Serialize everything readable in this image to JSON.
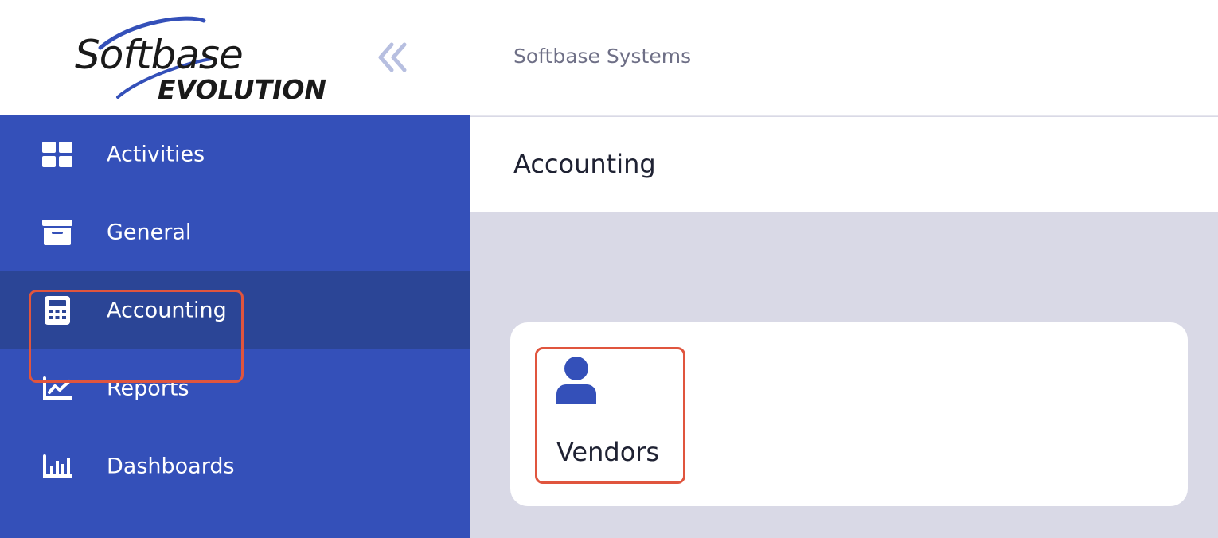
{
  "brand": {
    "logo_line1": "Softbase",
    "logo_line2": "EVOLUTION"
  },
  "header": {
    "org_name": "Softbase Systems",
    "page_title": "Accounting"
  },
  "sidebar": {
    "items": [
      {
        "label": "Activities",
        "icon": "grid-icon"
      },
      {
        "label": "General",
        "icon": "archive-box-icon"
      },
      {
        "label": "Accounting",
        "icon": "calculator-icon",
        "active": true
      },
      {
        "label": "Reports",
        "icon": "chart-line-icon"
      },
      {
        "label": "Dashboards",
        "icon": "bar-chart-icon"
      }
    ]
  },
  "main": {
    "tiles": [
      {
        "label": "Vendors",
        "icon": "user-icon"
      }
    ]
  },
  "colors": {
    "sidebar": "#3450b9",
    "sidebar_active": "#2b4596",
    "highlight": "#e0553e",
    "content_bg": "#d9d9e6"
  }
}
